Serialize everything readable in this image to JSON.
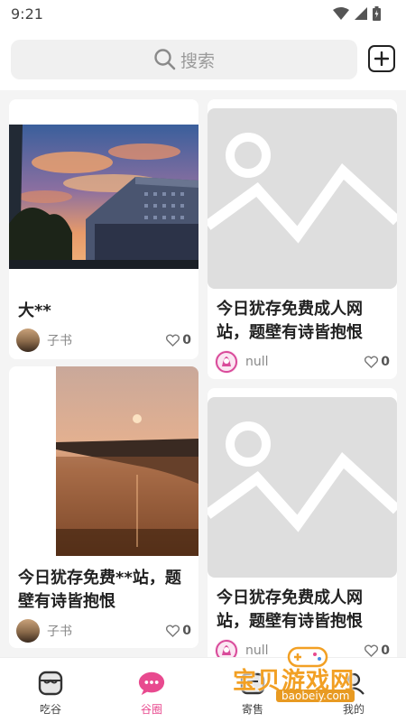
{
  "status_bar": {
    "time": "9:21"
  },
  "search": {
    "placeholder": "搜索"
  },
  "posts": [
    {
      "title": "大**",
      "author": "子书",
      "likes": "0",
      "image": "sunset-buildings"
    },
    {
      "title": "今日犹存免费成人网站，题壁有诗皆抱恨",
      "author": "null",
      "likes": "0",
      "image": "placeholder"
    },
    {
      "title": "今日犹存免费**站，题壁有诗皆抱恨",
      "author": "子书",
      "likes": "0",
      "image": "sunset-river"
    },
    {
      "title": "今日犹存免费成人网站，题壁有诗皆抱恨",
      "author": "null",
      "likes": "0",
      "image": "placeholder"
    }
  ],
  "tabs": [
    {
      "label": "吃谷",
      "icon": "shop-icon",
      "active": false
    },
    {
      "label": "谷圈",
      "icon": "chat-bubble-icon",
      "active": true
    },
    {
      "label": "寄售",
      "icon": "box-icon",
      "active": false
    },
    {
      "label": "我的",
      "icon": "profile-icon",
      "active": false
    }
  ],
  "watermark": {
    "text": "宝贝游戏网",
    "url": "baobeiy.com"
  },
  "colors": {
    "accent": "#e84a8f",
    "background": "#f4f4f4",
    "card": "#ffffff",
    "placeholder": "#dedede"
  }
}
